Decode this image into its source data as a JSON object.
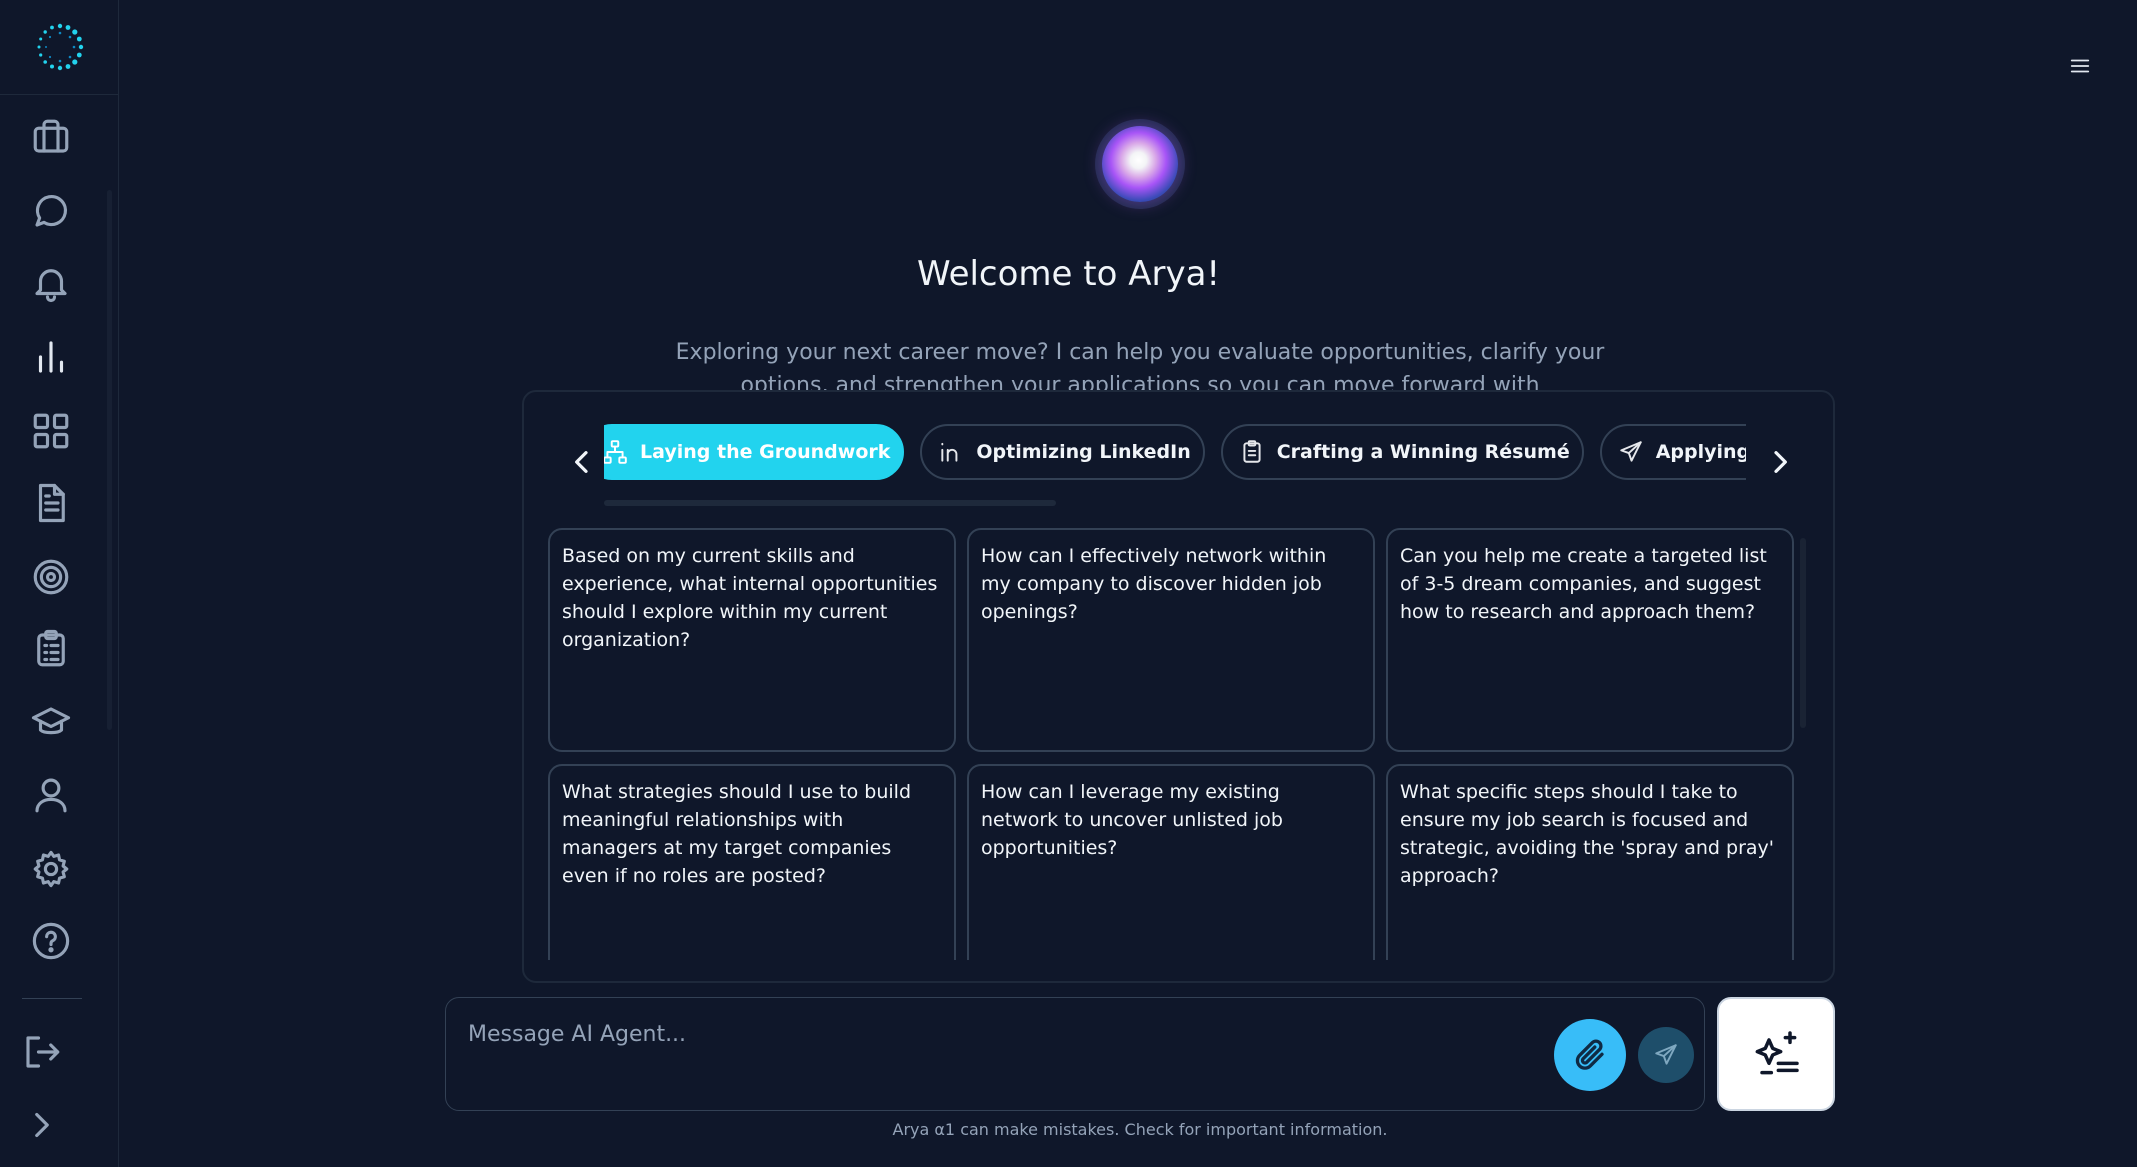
{
  "app": {
    "welcome_title": "Welcome to Arya!",
    "intro_text": "Exploring your next career move? I can help you evaluate opportunities, clarify your options, and strengthen your applications so you can move forward with",
    "accent_color": "#22d3ee"
  },
  "sidebar": {
    "items": [
      {
        "name": "briefcase-icon"
      },
      {
        "name": "chat-icon"
      },
      {
        "name": "bell-icon"
      },
      {
        "name": "bar-chart-icon",
        "active": true
      },
      {
        "name": "grid-icon"
      },
      {
        "name": "document-icon"
      },
      {
        "name": "target-icon"
      },
      {
        "name": "clipboard-icon"
      },
      {
        "name": "graduation-cap-icon"
      },
      {
        "name": "user-icon"
      },
      {
        "name": "settings-icon"
      },
      {
        "name": "help-icon"
      }
    ],
    "bottom": [
      {
        "name": "logout-icon"
      },
      {
        "name": "expand-chevron-icon"
      }
    ]
  },
  "tabs": [
    {
      "label": "Laying the Groundwork",
      "icon": "sitemap-icon",
      "active": true
    },
    {
      "label": "Optimizing LinkedIn",
      "icon": "linkedin-icon",
      "active": false
    },
    {
      "label": "Crafting a Winning Résumé",
      "icon": "clipboard-icon",
      "active": false
    },
    {
      "label": "Applying Effectively",
      "icon": "send-icon",
      "active": false
    }
  ],
  "prompts": [
    "Based on my current skills and experience, what internal opportunities should I explore within my current organization?",
    "How can I effectively network within my company to discover hidden job openings?",
    "Can you help me create a targeted list of 3-5 dream companies, and suggest how to research and approach them?",
    "What strategies should I use to build meaningful relationships with managers at my target companies even if no roles are posted?",
    "How can I leverage my existing network to uncover unlisted job opportunities?",
    "What specific steps should I take to ensure my job search is focused and strategic, avoiding the 'spray and pray' approach?"
  ],
  "composer": {
    "placeholder": "Message AI Agent...",
    "value": ""
  },
  "disclaimer": "Arya α1 can make mistakes. Check for important information."
}
